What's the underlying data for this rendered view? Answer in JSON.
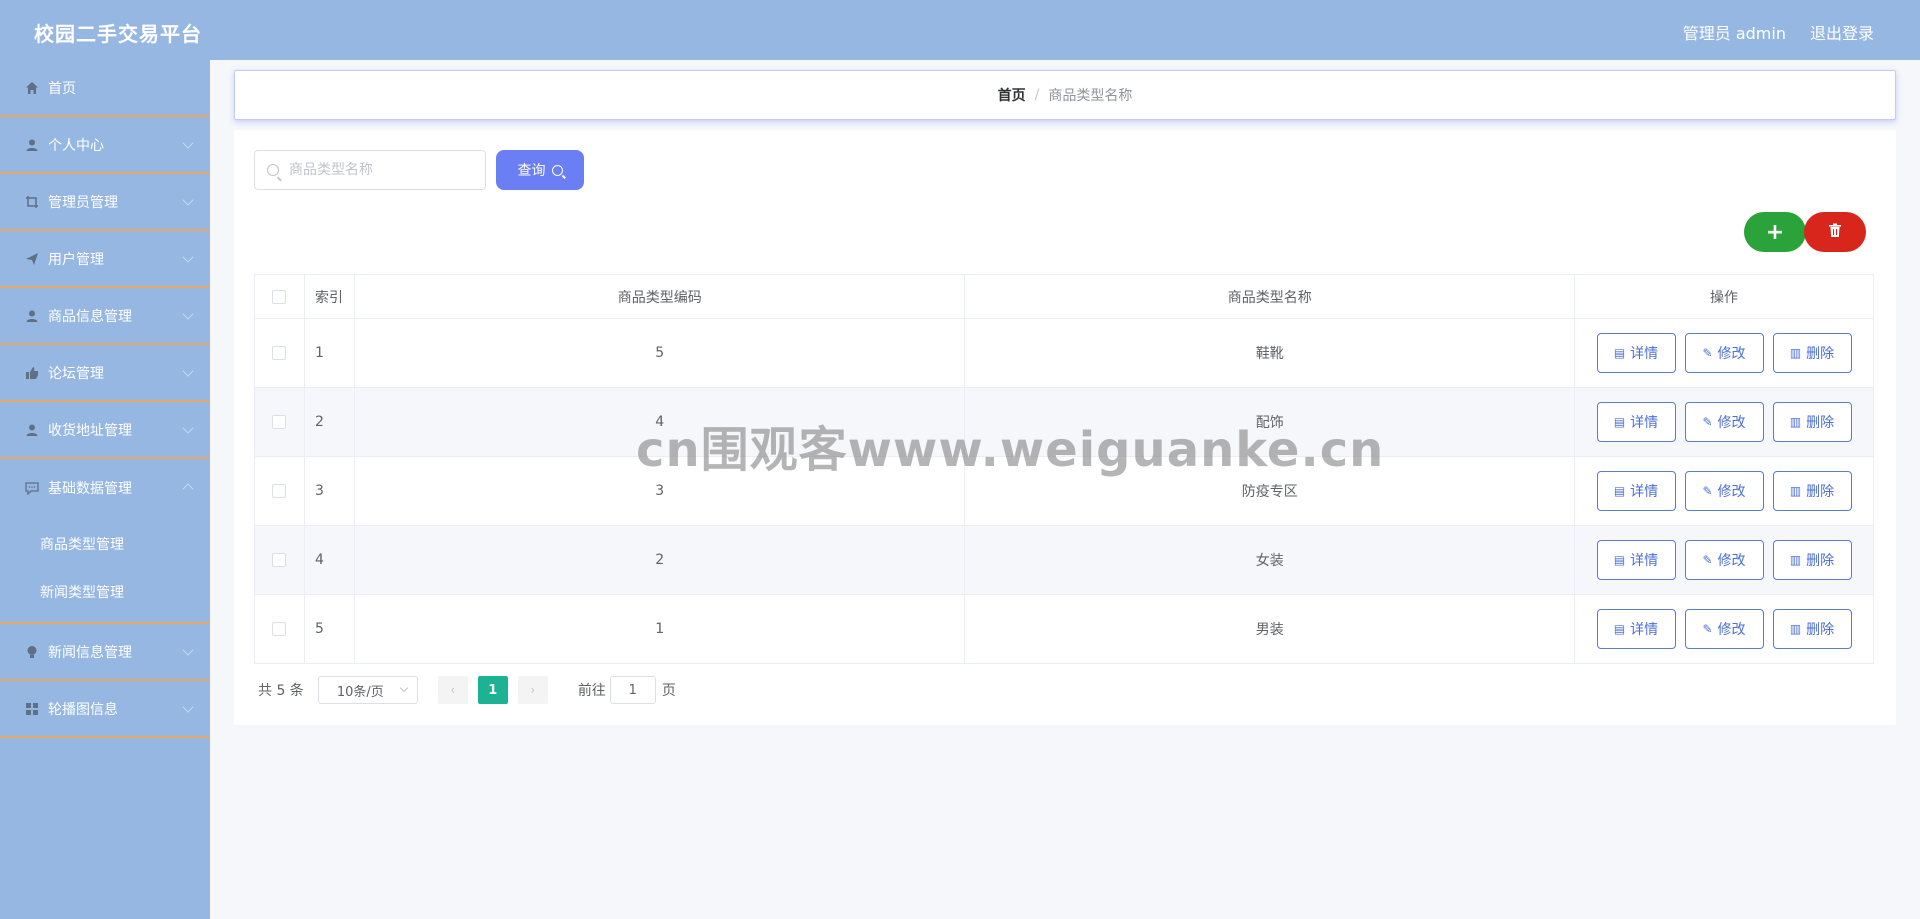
{
  "header": {
    "brand": "校园二手交易平台",
    "user_label": "管理员 admin",
    "logout_label": "退出登录"
  },
  "sidebar": {
    "items": [
      {
        "label": "首页",
        "icon": "home-icon"
      },
      {
        "label": "个人中心",
        "icon": "user-icon"
      },
      {
        "label": "管理员管理",
        "icon": "crop-icon"
      },
      {
        "label": "用户管理",
        "icon": "send-icon"
      },
      {
        "label": "商品信息管理",
        "icon": "user-icon"
      },
      {
        "label": "论坛管理",
        "icon": "thumb-icon"
      },
      {
        "label": "收货地址管理",
        "icon": "user-icon"
      },
      {
        "label": "基础数据管理",
        "icon": "chat-icon",
        "expanded": true,
        "children": [
          {
            "label": "商品类型管理"
          },
          {
            "label": "新闻类型管理"
          }
        ]
      },
      {
        "label": "新闻信息管理",
        "icon": "bulb-icon"
      },
      {
        "label": "轮播图信息",
        "icon": "grid-icon"
      }
    ]
  },
  "breadcrumb": {
    "home": "首页",
    "separator": "/",
    "current": "商品类型名称"
  },
  "search": {
    "placeholder": "商品类型名称",
    "value": "",
    "query_label": "查询"
  },
  "table": {
    "headers": {
      "index": "索引",
      "code": "商品类型编码",
      "name": "商品类型名称",
      "ops": "操作"
    },
    "rows": [
      {
        "index": "1",
        "code": "5",
        "name": "鞋靴"
      },
      {
        "index": "2",
        "code": "4",
        "name": "配饰"
      },
      {
        "index": "3",
        "code": "3",
        "name": "防疫专区"
      },
      {
        "index": "4",
        "code": "2",
        "name": "女装"
      },
      {
        "index": "5",
        "code": "1",
        "name": "男装"
      }
    ],
    "op_labels": {
      "detail": "详情",
      "edit": "修改",
      "delete": "删除"
    }
  },
  "pagination": {
    "total_label": "共 5 条",
    "page_size": "10条/页",
    "current_page": "1",
    "goto_label": "前往",
    "goto_value": "1",
    "page_unit": "页"
  },
  "watermark": "cn围观客www.weiguanke.cn",
  "colors": {
    "sidebar_bg": "#95b7e2",
    "accent": "#6b7ff5",
    "add_button": "#2aa33a",
    "delete_button": "#d9261c",
    "pager_active": "#1bb394",
    "divider": "#e9a66a"
  }
}
